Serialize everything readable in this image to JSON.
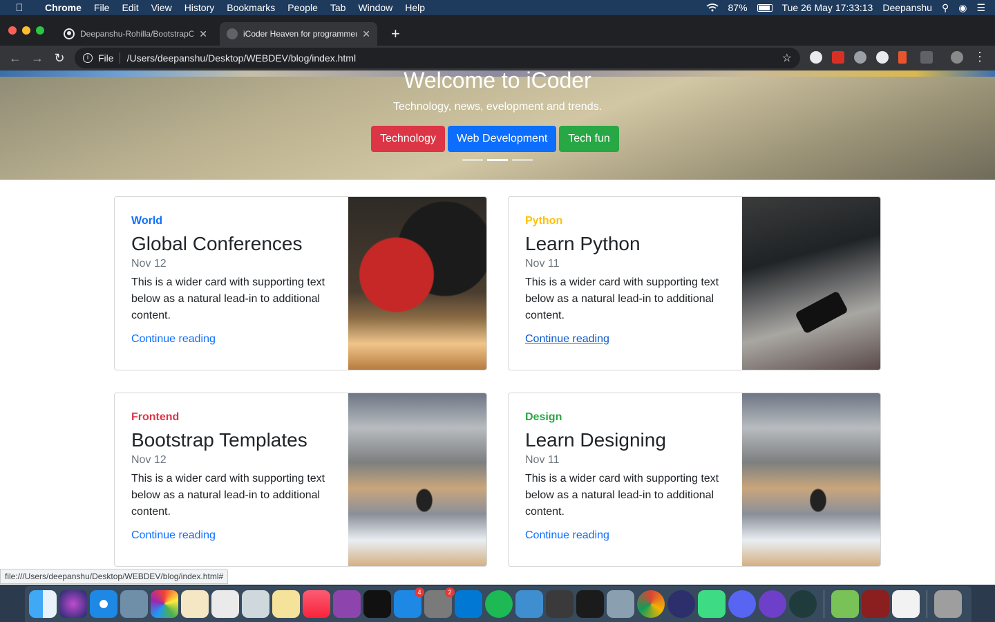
{
  "menubar": {
    "app": "Chrome",
    "items": [
      "File",
      "Edit",
      "View",
      "History",
      "Bookmarks",
      "People",
      "Tab",
      "Window",
      "Help"
    ],
    "battery": "87%",
    "clock": "Tue 26 May  17:33:13",
    "user": "Deepanshu"
  },
  "browser": {
    "tabs": [
      {
        "title": "Deepanshu-Rohilla/BootstrapC"
      },
      {
        "title": "iCoder Heaven for programmers"
      }
    ],
    "scheme": "File",
    "url": "/Users/deepanshu/Desktop/WEBDEV/blog/index.html",
    "status_url": "file:///Users/deepanshu/Desktop/WEBDEV/blog/index.html#"
  },
  "hero": {
    "title": "Welcome to iCoder",
    "subtitle": "Technology, news, evelopment and trends.",
    "buttons": [
      {
        "label": "Technology",
        "color": "#dc3545"
      },
      {
        "label": "Web Development",
        "color": "#0d6efd"
      },
      {
        "label": "Tech fun",
        "color": "#28a745"
      }
    ],
    "active_slide": 2
  },
  "cards": [
    {
      "category": "World",
      "category_color": "#0d6efd",
      "title": "Global Conferences",
      "date": "Nov 12",
      "text": "This is a wider card with supporting text below as a natural lead-in to additional content.",
      "link": "Continue reading"
    },
    {
      "category": "Python",
      "category_color": "#ffc107",
      "title": "Learn Python",
      "date": "Nov 11",
      "text": "This is a wider card with supporting text below as a natural lead-in to additional content.",
      "link": "Continue reading"
    },
    {
      "category": "Frontend",
      "category_color": "#dc3545",
      "title": "Bootstrap Templates",
      "date": "Nov 12",
      "text": "This is a wider card with supporting text below as a natural lead-in to additional content.",
      "link": "Continue reading"
    },
    {
      "category": "Design",
      "category_color": "#28a745",
      "title": "Learn Designing",
      "date": "Nov 11",
      "text": "This is a wider card with supporting text below as a natural lead-in to additional content.",
      "link": "Continue reading"
    }
  ],
  "dock": {
    "app_store_badge": "4",
    "settings_badge": "2"
  }
}
